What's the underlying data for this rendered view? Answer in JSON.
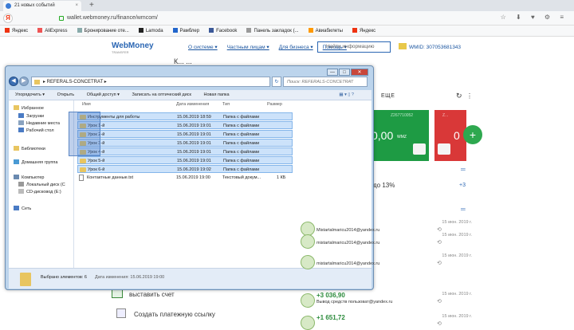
{
  "browser": {
    "tab_title": "21 новых событий",
    "tab_close": "×",
    "new_tab": "+",
    "url": "wallet.webmoney.ru/finance/wmcom/",
    "addr_icons": "☆ ⬇ ♥ ⚙ ≡",
    "yandex_button": "Я",
    "bookmarks": [
      {
        "label": "Яндекс",
        "color": "#e31"
      },
      {
        "label": "AliExpress",
        "color": "#e55"
      },
      {
        "label": "Бронирование оте...",
        "color": "#8aa"
      },
      {
        "label": "Lamoda",
        "color": "#222"
      },
      {
        "label": "Рамблер",
        "color": "#26c"
      },
      {
        "label": "Facebook",
        "color": "#3b5998"
      },
      {
        "label": "Панель закладок (...",
        "color": "#999"
      },
      {
        "label": "Авиабилеты",
        "color": "#f90"
      },
      {
        "label": "Яндекс",
        "color": "#e31"
      }
    ]
  },
  "wm": {
    "logo": "WebMoney",
    "logo_sub": "TRANSFER",
    "nav": [
      "О системе ▾",
      "Частным лицам ▾",
      "Для бизнеса ▾",
      "Помощь ▾"
    ],
    "search_placeholder": "Найти информацию",
    "wmid": "WMID: 307053681343",
    "header_partial": "К... ...",
    "more_label": "ЕЩЕ",
    "refresh_icon": "↻",
    "more_icon": "⋮",
    "card_green": {
      "number": "Z267710052",
      "value": "0,00",
      "currency": "WMZ"
    },
    "card_red": {
      "number": "Z...",
      "value": "0"
    },
    "plus_button": "+",
    "deposit_text": "до 13%",
    "plus3": "+3",
    "equal_icon": "═",
    "transactions": [
      {
        "date": "15 июн. 2019 г.",
        "email": "Mistartalmaricu2014@yandex.ru",
        "amount": ""
      },
      {
        "date": "15 июн. 2019 г.",
        "email": "mistartalmaricu2014@yandex.ru",
        "amount": ""
      },
      {
        "date": "15 июн. 2019 г.",
        "email": "mistartalmaricu2014@yandex.ru",
        "amount": ""
      },
      {
        "date": "15 июн. 2019 г.",
        "email": "Вывод средств пользоват@yandex.ru",
        "amount": "+3 036,90"
      },
      {
        "date": "15 июн. 2019 г.",
        "email": "",
        "amount": "+1 651,72"
      }
    ],
    "bottom_link1": "выставить счет",
    "bottom_link2": "Создать платежную ссылку"
  },
  "explorer": {
    "window_controls": [
      "—",
      "□",
      "✕"
    ],
    "back": "◀",
    "forward": "▶",
    "path": "▸ REFERALS-CONCETRAT ▸",
    "search_placeholder": "Поиск: REFERALS-CONCETRAT",
    "refresh": "↻",
    "commands": [
      "Упорядочить ▾",
      "Открыть",
      "Общий доступ ▾",
      "Записать на оптический диск",
      "Новая папка"
    ],
    "cmd_right": "▦ ▾  ▯  ?",
    "nav_items": [
      {
        "label": "Избранное",
        "color": "#e8c560"
      },
      {
        "label": "Загрузки",
        "color": "#4a7bc4"
      },
      {
        "label": "Недавние места",
        "color": "#8aa3c0"
      },
      {
        "label": "Рабочий стол",
        "color": "#4a7bc4"
      },
      {
        "label": "Библиотеки",
        "color": "#e8c560"
      },
      {
        "label": "Домашняя группа",
        "color": "#4a9ad4"
      },
      {
        "label": "Компьютер",
        "color": "#6a8ab0"
      },
      {
        "label": "Локальный диск (C",
        "color": "#999"
      },
      {
        "label": "CD-дисковод (E:)",
        "color": "#bbb"
      },
      {
        "label": "Сеть",
        "color": "#4a7bc4"
      }
    ],
    "columns": [
      "Имя",
      "Дата изменения",
      "Тип",
      "Размер"
    ],
    "files": [
      {
        "name": "Инструменты для работы",
        "date": "15.06.2019 18:59",
        "type": "Папка с файлами",
        "size": "",
        "kind": "folder"
      },
      {
        "name": "Урок 1-й",
        "date": "15.06.2019 19:01",
        "type": "Папка с файлами",
        "size": "",
        "kind": "folder"
      },
      {
        "name": "Урок 2-й",
        "date": "15.06.2019 19:01",
        "type": "Папка с файлами",
        "size": "",
        "kind": "folder"
      },
      {
        "name": "Урок 3-й",
        "date": "15.06.2019 19:01",
        "type": "Папка с файлами",
        "size": "",
        "kind": "folder"
      },
      {
        "name": "Урок 4-й",
        "date": "15.06.2019 19:01",
        "type": "Папка с файлами",
        "size": "",
        "kind": "folder"
      },
      {
        "name": "Урок 5-й",
        "date": "15.06.2019 19:01",
        "type": "Папка с файлами",
        "size": "",
        "kind": "folder"
      },
      {
        "name": "Урок 6-й",
        "date": "15.06.2019 19:02",
        "type": "Папка с файлами",
        "size": "",
        "kind": "folder"
      },
      {
        "name": "Контактные данные.txt",
        "date": "15.06.2019 19:00",
        "type": "Текстовый докум...",
        "size": "1 КБ",
        "kind": "text"
      }
    ],
    "status_selected": "Выбрано элементов: 6",
    "status_date": "Дата изменения: 15.06.2019 19:00"
  }
}
